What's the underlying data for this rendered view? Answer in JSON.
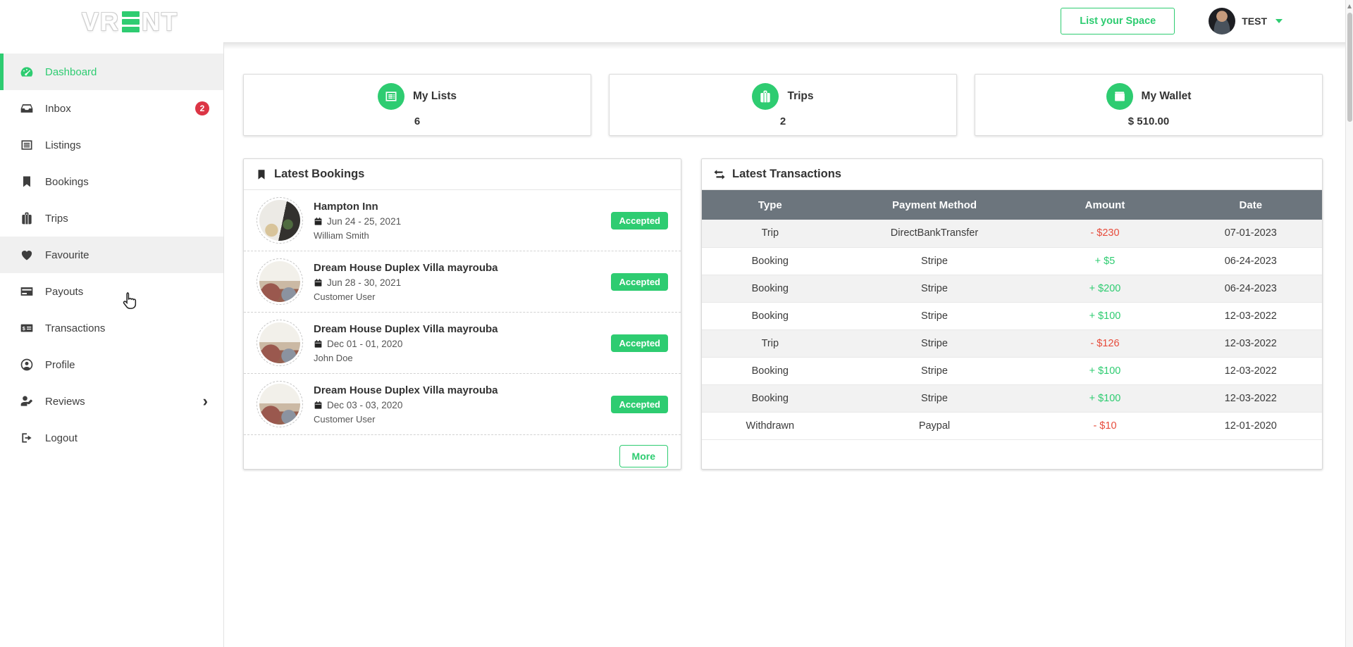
{
  "colors": {
    "accent": "#2ecc71",
    "danger": "#e74c3c",
    "badge_red": "#dc3545",
    "table_header": "#6c757d"
  },
  "header": {
    "logo_left": "VR",
    "logo_right": "NT",
    "list_space_button": "List your Space",
    "user_name": "TEST"
  },
  "sidebar": {
    "items": [
      {
        "label": "Dashboard",
        "icon": "dashboard-icon",
        "state": "active"
      },
      {
        "label": "Inbox",
        "icon": "inbox-icon",
        "badge": "2"
      },
      {
        "label": "Listings",
        "icon": "listings-icon"
      },
      {
        "label": "Bookings",
        "icon": "bookmark-icon"
      },
      {
        "label": "Trips",
        "icon": "suitcase-icon"
      },
      {
        "label": "Favourite",
        "icon": "heart-icon",
        "state": "hover"
      },
      {
        "label": "Payouts",
        "icon": "credit-card-icon"
      },
      {
        "label": "Transactions",
        "icon": "money-check-icon"
      },
      {
        "label": "Profile",
        "icon": "user-circle-icon"
      },
      {
        "label": "Reviews",
        "icon": "user-edit-icon",
        "chevron": "›"
      },
      {
        "label": "Logout",
        "icon": "logout-icon"
      }
    ]
  },
  "stats": [
    {
      "label": "My Lists",
      "value": "6",
      "icon": "list-icon"
    },
    {
      "label": "Trips",
      "value": "2",
      "icon": "briefcase-icon"
    },
    {
      "label": "My Wallet",
      "value": "$ 510.00",
      "icon": "wallet-icon"
    }
  ],
  "bookings": {
    "title": "Latest Bookings",
    "more_label": "More",
    "items": [
      {
        "name": "Hampton Inn",
        "dates": "Jun 24 - 25, 2021",
        "guest": "William Smith",
        "status": "Accepted",
        "photo": "photo-a"
      },
      {
        "name": "Dream House Duplex Villa mayrouba",
        "dates": "Jun 28 - 30, 2021",
        "guest": "Customer User",
        "status": "Accepted",
        "photo": "photo-b"
      },
      {
        "name": "Dream House Duplex Villa mayrouba",
        "dates": "Dec 01 - 01, 2020",
        "guest": "John Doe",
        "status": "Accepted",
        "photo": "photo-b"
      },
      {
        "name": "Dream House Duplex Villa mayrouba",
        "dates": "Dec 03 - 03, 2020",
        "guest": "Customer User",
        "status": "Accepted",
        "photo": "photo-b"
      }
    ]
  },
  "transactions": {
    "title": "Latest Transactions",
    "columns": [
      "Type",
      "Payment Method",
      "Amount",
      "Date"
    ],
    "rows": [
      {
        "type": "Trip",
        "method": "DirectBankTransfer",
        "amount": "- $230",
        "direction": "neg",
        "date": "07-01-2023"
      },
      {
        "type": "Booking",
        "method": "Stripe",
        "amount": "+ $5",
        "direction": "pos",
        "date": "06-24-2023"
      },
      {
        "type": "Booking",
        "method": "Stripe",
        "amount": "+ $200",
        "direction": "pos",
        "date": "06-24-2023"
      },
      {
        "type": "Booking",
        "method": "Stripe",
        "amount": "+ $100",
        "direction": "pos",
        "date": "12-03-2022"
      },
      {
        "type": "Trip",
        "method": "Stripe",
        "amount": "- $126",
        "direction": "neg",
        "date": "12-03-2022"
      },
      {
        "type": "Booking",
        "method": "Stripe",
        "amount": "+ $100",
        "direction": "pos",
        "date": "12-03-2022"
      },
      {
        "type": "Booking",
        "method": "Stripe",
        "amount": "+ $100",
        "direction": "pos",
        "date": "12-03-2022"
      },
      {
        "type": "Withdrawn",
        "method": "Paypal",
        "amount": "- $10",
        "direction": "neg",
        "date": "12-01-2020"
      }
    ]
  }
}
